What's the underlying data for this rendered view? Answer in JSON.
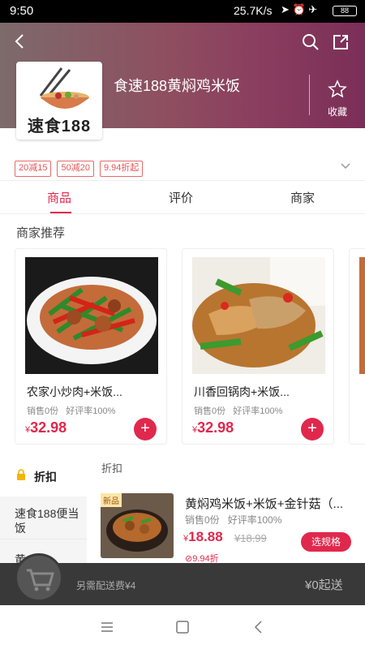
{
  "status_bar": {
    "time": "9:50",
    "network_speed": "25.7K/s",
    "battery": "88"
  },
  "store": {
    "name": "食速188黄焖鸡米饭",
    "logo_text": "速食188",
    "favorite_label": "收藏"
  },
  "promos": [
    "20减15",
    "50减20",
    "9.94折起"
  ],
  "tabs": [
    {
      "label": "商品",
      "active": true
    },
    {
      "label": "评价",
      "active": false
    },
    {
      "label": "商家",
      "active": false
    }
  ],
  "recommend": {
    "title": "商家推荐",
    "items": [
      {
        "name": "农家小炒肉+米饭...",
        "sales": "销售0份",
        "rating": "好评率100%",
        "currency": "¥",
        "price": "32.98"
      },
      {
        "name": "川香回锅肉+米饭...",
        "sales": "销售0份",
        "rating": "好评率100%",
        "currency": "¥",
        "price": "32.98"
      }
    ]
  },
  "categories": {
    "active": "折扣",
    "items": [
      "速食188便当饭",
      "黄"
    ]
  },
  "list": {
    "header": "折扣",
    "item": {
      "badge": "新品",
      "name": "黄焖鸡米饭+米饭+金针菇（...",
      "sales": "销售0份",
      "rating": "好评率100%",
      "currency": "¥",
      "price": "18.88",
      "old_price": "¥18.99",
      "discount": "9.94折",
      "spec_button": "选规格"
    }
  },
  "cart": {
    "delivery_note": "另需配送费¥4",
    "min_order": "¥0起送"
  },
  "colors": {
    "accent": "#e0284d",
    "header_gradient_end": "#7b2e57"
  }
}
